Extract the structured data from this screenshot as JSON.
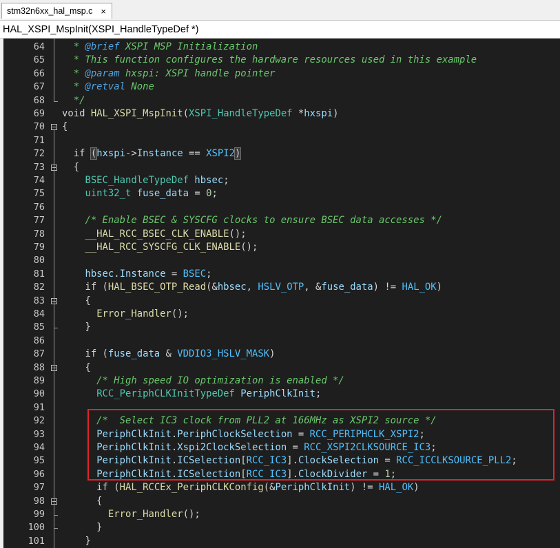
{
  "tab": {
    "filename": "stm32n6xx_hal_msp.c",
    "close_glyph": "×"
  },
  "function_bar": {
    "signature": "HAL_XSPI_MspInit(XSPI_HandleTypeDef *)"
  },
  "highlight_color": "#e0242b",
  "editor": {
    "lines": [
      {
        "num": "64",
        "t": [
          [
            "  * ",
            "cmt"
          ],
          [
            "@brief",
            "tag"
          ],
          [
            " XSPI MSP Initialization",
            "cmt"
          ]
        ]
      },
      {
        "num": "65",
        "t": [
          [
            "  * This function configures the hardware resources used in this example",
            "cmt"
          ]
        ]
      },
      {
        "num": "66",
        "t": [
          [
            "  * ",
            "cmt"
          ],
          [
            "@param",
            "tag"
          ],
          [
            " hxspi: XSPI handle pointer",
            "cmt"
          ]
        ]
      },
      {
        "num": "67",
        "t": [
          [
            "  * ",
            "cmt"
          ],
          [
            "@retval",
            "tag"
          ],
          [
            " None",
            "cmt"
          ]
        ]
      },
      {
        "num": "68",
        "t": [
          [
            "  */",
            "cmt"
          ]
        ]
      },
      {
        "num": "69",
        "t": [
          [
            "void ",
            "kw"
          ],
          [
            "HAL_XSPI_MspInit",
            "fn"
          ],
          [
            "(",
            "op"
          ],
          [
            "XSPI_HandleTypeDef",
            "typ"
          ],
          [
            " *",
            "op"
          ],
          [
            "hxspi",
            "var"
          ],
          [
            ")",
            "op"
          ]
        ]
      },
      {
        "num": "70",
        "t": [
          [
            "{",
            "op"
          ]
        ]
      },
      {
        "num": "71",
        "t": []
      },
      {
        "num": "72",
        "t": [
          [
            "  if ",
            "kw"
          ],
          [
            "(",
            "brk"
          ],
          [
            "hxspi",
            "var"
          ],
          [
            "->",
            "op"
          ],
          [
            "Instance",
            "fld"
          ],
          [
            " == ",
            "op"
          ],
          [
            "XSPI2",
            "mac"
          ],
          [
            ")",
            "brk"
          ]
        ]
      },
      {
        "num": "73",
        "t": [
          [
            "  {",
            "op"
          ]
        ]
      },
      {
        "num": "74",
        "t": [
          [
            "    ",
            "op"
          ],
          [
            "BSEC_HandleTypeDef",
            "typ"
          ],
          [
            " ",
            "op"
          ],
          [
            "hbsec",
            "var"
          ],
          [
            ";",
            "op"
          ]
        ]
      },
      {
        "num": "75",
        "t": [
          [
            "    ",
            "op"
          ],
          [
            "uint32_t",
            "typ"
          ],
          [
            " ",
            "op"
          ],
          [
            "fuse_data",
            "var"
          ],
          [
            " = ",
            "op"
          ],
          [
            "0",
            "num"
          ],
          [
            ";",
            "op"
          ]
        ]
      },
      {
        "num": "76",
        "t": []
      },
      {
        "num": "77",
        "t": [
          [
            "    /* Enable BSEC & SYSCFG clocks to ensure BSEC data accesses */",
            "cmt"
          ]
        ]
      },
      {
        "num": "78",
        "t": [
          [
            "    ",
            "op"
          ],
          [
            "__HAL_RCC_BSEC_CLK_ENABLE",
            "fn"
          ],
          [
            "();",
            "op"
          ]
        ]
      },
      {
        "num": "79",
        "t": [
          [
            "    ",
            "op"
          ],
          [
            "__HAL_RCC_SYSCFG_CLK_ENABLE",
            "fn"
          ],
          [
            "();",
            "op"
          ]
        ]
      },
      {
        "num": "80",
        "t": []
      },
      {
        "num": "81",
        "t": [
          [
            "    ",
            "op"
          ],
          [
            "hbsec",
            "var"
          ],
          [
            ".",
            "op"
          ],
          [
            "Instance",
            "fld"
          ],
          [
            " = ",
            "op"
          ],
          [
            "BSEC",
            "mac"
          ],
          [
            ";",
            "op"
          ]
        ]
      },
      {
        "num": "82",
        "t": [
          [
            "    if (",
            "kw"
          ],
          [
            "HAL_BSEC_OTP_Read",
            "fn"
          ],
          [
            "(&",
            "op"
          ],
          [
            "hbsec",
            "var"
          ],
          [
            ", ",
            "op"
          ],
          [
            "HSLV_OTP",
            "mac"
          ],
          [
            ", &",
            "op"
          ],
          [
            "fuse_data",
            "var"
          ],
          [
            ") != ",
            "op"
          ],
          [
            "HAL_OK",
            "mac"
          ],
          [
            ")",
            "op"
          ]
        ]
      },
      {
        "num": "83",
        "t": [
          [
            "    {",
            "op"
          ]
        ]
      },
      {
        "num": "84",
        "t": [
          [
            "      ",
            "op"
          ],
          [
            "Error_Handler",
            "fn"
          ],
          [
            "();",
            "op"
          ]
        ]
      },
      {
        "num": "85",
        "t": [
          [
            "    }",
            "op"
          ]
        ]
      },
      {
        "num": "86",
        "t": []
      },
      {
        "num": "87",
        "t": [
          [
            "    if (",
            "kw"
          ],
          [
            "fuse_data",
            "var"
          ],
          [
            " & ",
            "op"
          ],
          [
            "VDDIO3_HSLV_MASK",
            "mac"
          ],
          [
            ")",
            "op"
          ]
        ]
      },
      {
        "num": "88",
        "t": [
          [
            "    {",
            "op"
          ]
        ]
      },
      {
        "num": "89",
        "t": [
          [
            "      /* High speed IO optimization is enabled */",
            "cmt"
          ]
        ]
      },
      {
        "num": "90",
        "t": [
          [
            "      ",
            "op"
          ],
          [
            "RCC_PeriphCLKInitTypeDef",
            "typ"
          ],
          [
            " ",
            "op"
          ],
          [
            "PeriphClkInit",
            "var"
          ],
          [
            ";",
            "op"
          ]
        ]
      },
      {
        "num": "91",
        "t": []
      },
      {
        "num": "92",
        "t": [
          [
            "      /*  Select IC3 clock from PLL2 at 166MHz as XSPI2 source */",
            "cmt"
          ]
        ]
      },
      {
        "num": "93",
        "t": [
          [
            "      ",
            "op"
          ],
          [
            "PeriphClkInit",
            "var"
          ],
          [
            ".",
            "op"
          ],
          [
            "PeriphClockSelection",
            "fld"
          ],
          [
            " = ",
            "op"
          ],
          [
            "RCC_PERIPHCLK_XSPI2",
            "mac"
          ],
          [
            ";",
            "op"
          ]
        ]
      },
      {
        "num": "94",
        "t": [
          [
            "      ",
            "op"
          ],
          [
            "PeriphClkInit",
            "var"
          ],
          [
            ".",
            "op"
          ],
          [
            "Xspi2ClockSelection",
            "fld"
          ],
          [
            " = ",
            "op"
          ],
          [
            "RCC_XSPI2CLKSOURCE_IC3",
            "mac"
          ],
          [
            ";",
            "op"
          ]
        ]
      },
      {
        "num": "95",
        "t": [
          [
            "      ",
            "op"
          ],
          [
            "PeriphClkInit",
            "var"
          ],
          [
            ".",
            "op"
          ],
          [
            "ICSelection",
            "fld"
          ],
          [
            "[",
            "op"
          ],
          [
            "RCC_IC3",
            "mac"
          ],
          [
            "].",
            "op"
          ],
          [
            "ClockSelection",
            "fld"
          ],
          [
            " = ",
            "op"
          ],
          [
            "RCC_ICCLKSOURCE_PLL2",
            "mac"
          ],
          [
            ";",
            "op"
          ]
        ]
      },
      {
        "num": "96",
        "t": [
          [
            "      ",
            "op"
          ],
          [
            "PeriphClkInit",
            "var"
          ],
          [
            ".",
            "op"
          ],
          [
            "ICSelection",
            "fld"
          ],
          [
            "[",
            "op"
          ],
          [
            "RCC_IC3",
            "mac"
          ],
          [
            "].",
            "op"
          ],
          [
            "ClockDivider",
            "fld"
          ],
          [
            " = ",
            "op"
          ],
          [
            "1",
            "num"
          ],
          [
            ";",
            "op"
          ]
        ]
      },
      {
        "num": "97",
        "t": [
          [
            "      if (",
            "kw"
          ],
          [
            "HAL_RCCEx_PeriphCLKConfig",
            "fn"
          ],
          [
            "(&",
            "op"
          ],
          [
            "PeriphClkInit",
            "var"
          ],
          [
            ") != ",
            "op"
          ],
          [
            "HAL_OK",
            "mac"
          ],
          [
            ")",
            "op"
          ]
        ]
      },
      {
        "num": "98",
        "t": [
          [
            "      {",
            "op"
          ]
        ]
      },
      {
        "num": "99",
        "t": [
          [
            "        ",
            "op"
          ],
          [
            "Error_Handler",
            "fn"
          ],
          [
            "();",
            "op"
          ]
        ]
      },
      {
        "num": "100",
        "t": [
          [
            "      }",
            "op"
          ]
        ]
      },
      {
        "num": "101",
        "t": [
          [
            "    }",
            "op"
          ]
        ]
      }
    ]
  }
}
